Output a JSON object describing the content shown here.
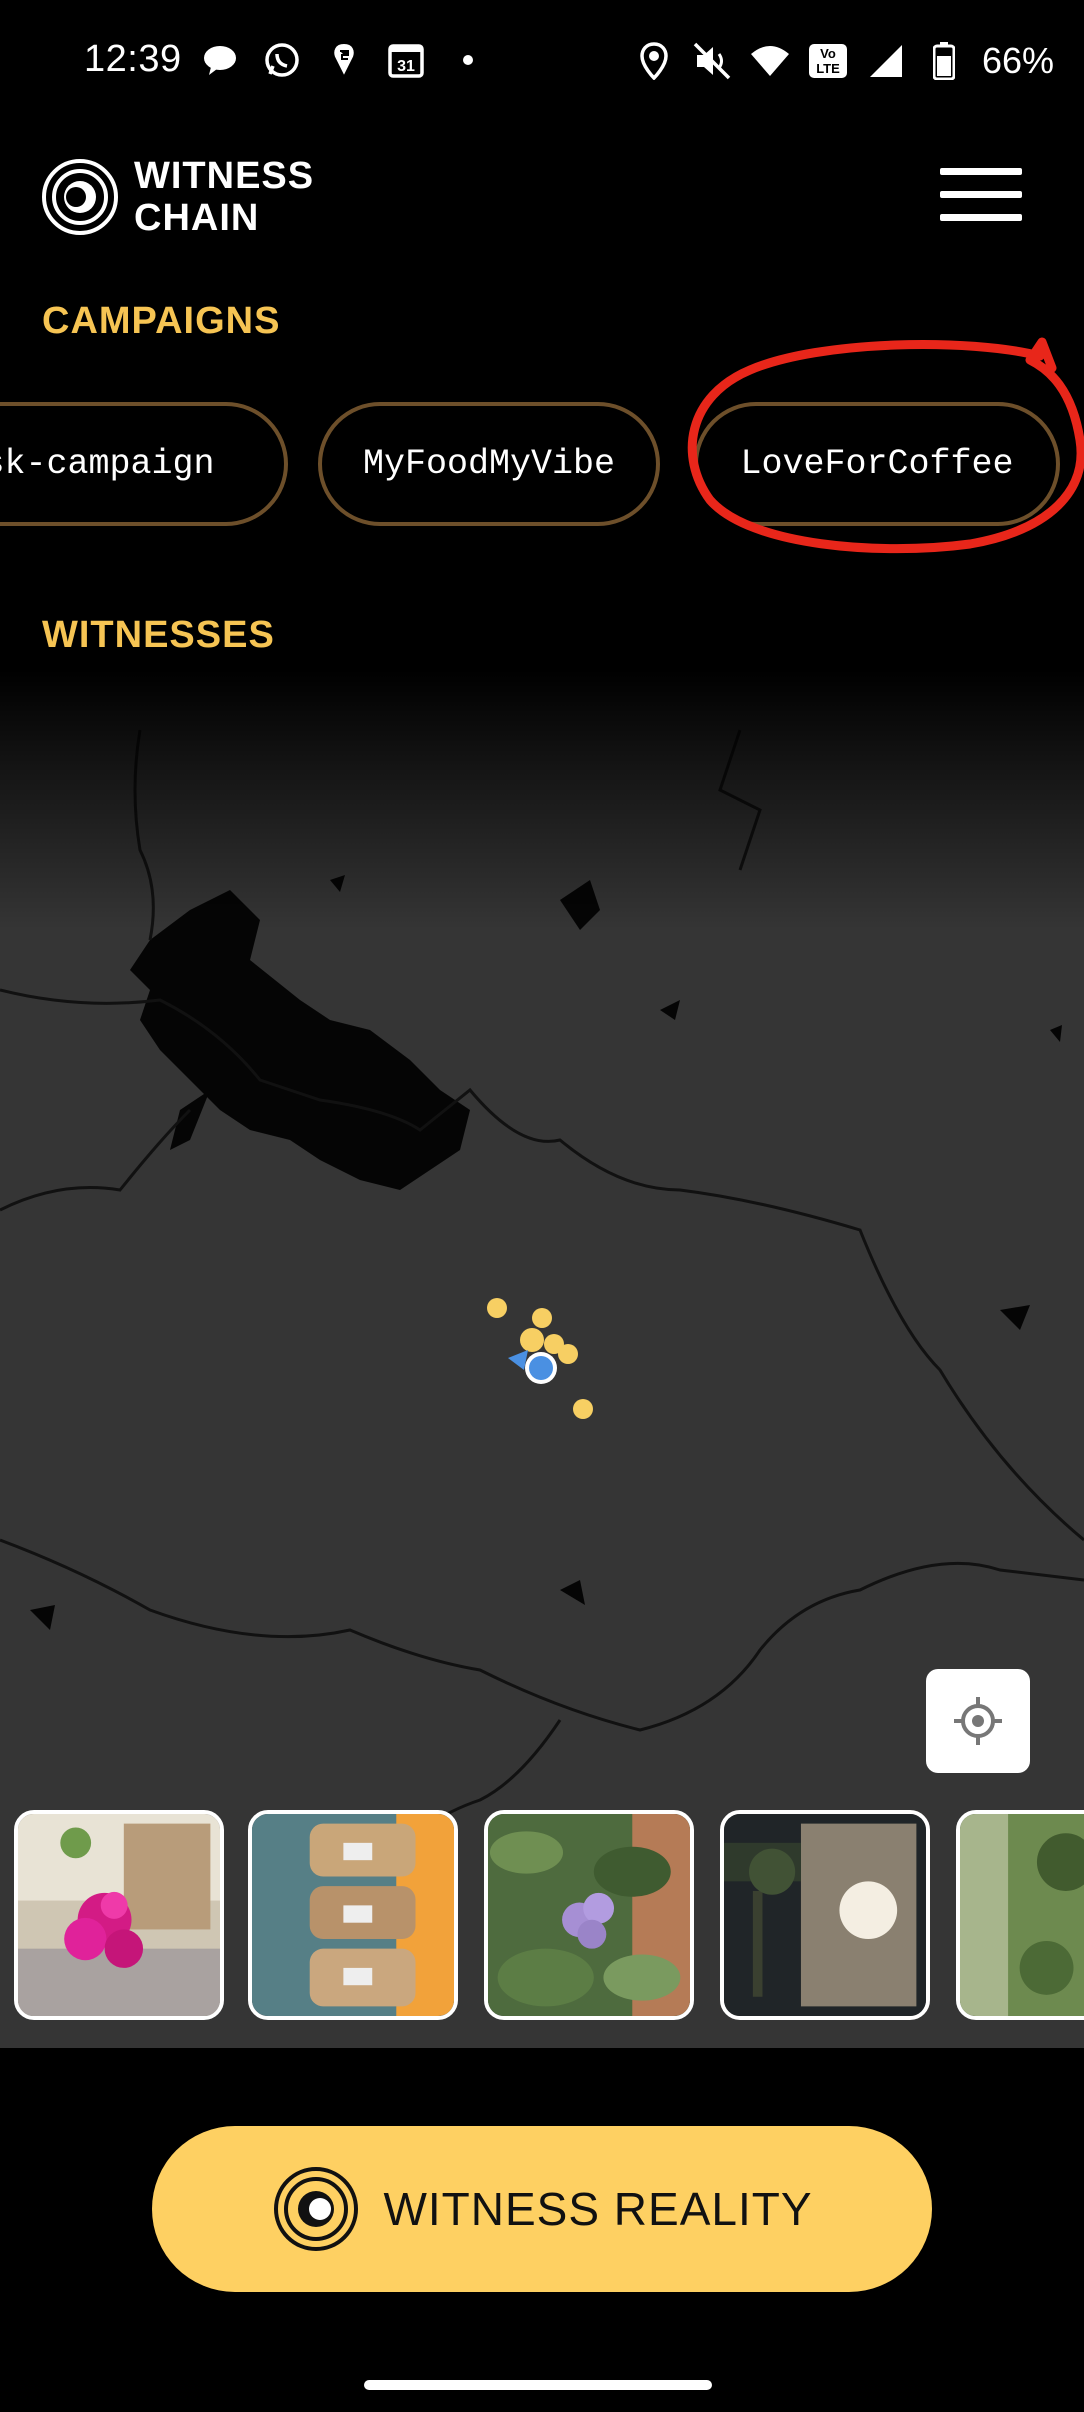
{
  "status_bar": {
    "time": "12:39",
    "battery": "66%",
    "icons_left": [
      "chat-bubble-icon",
      "whatsapp-icon",
      "swiggy-icon",
      "calendar-icon",
      "dot-icon"
    ],
    "calendar_day": "31",
    "icons_right": [
      "location-icon",
      "mute-icon",
      "wifi-icon",
      "volte-icon",
      "signal-icon",
      "battery-icon"
    ],
    "volte_text": "Vo LTE"
  },
  "header": {
    "brand_line1": "WITNESS",
    "brand_line2": "CHAIN",
    "menu_icon": "hamburger-icon"
  },
  "campaigns": {
    "title": "CAMPAIGNS",
    "items": [
      {
        "label": "sk-campaign"
      },
      {
        "label": "MyFoodMyVibe"
      },
      {
        "label": "LoveForCoffee"
      }
    ],
    "annotated_item": "LoveForCoffee",
    "annotation_color": "#e8261a"
  },
  "witnesses": {
    "title": "WITNESSES",
    "thumbnails": [
      {
        "icon": "pink-flower-photo"
      },
      {
        "icon": "jars-shelf-photo"
      },
      {
        "icon": "purple-flower-photo"
      },
      {
        "icon": "night-building-photo"
      },
      {
        "icon": "garden-photo"
      }
    ]
  },
  "map": {
    "locate_icon": "my-location-icon"
  },
  "cta": {
    "label": "WITNESS REALITY"
  },
  "colors": {
    "accent": "#f6c453",
    "cta_bg": "#fed062",
    "chip_border": "#6d4f2a",
    "map_bg": "#353535",
    "user_dot": "#4a90e2"
  }
}
